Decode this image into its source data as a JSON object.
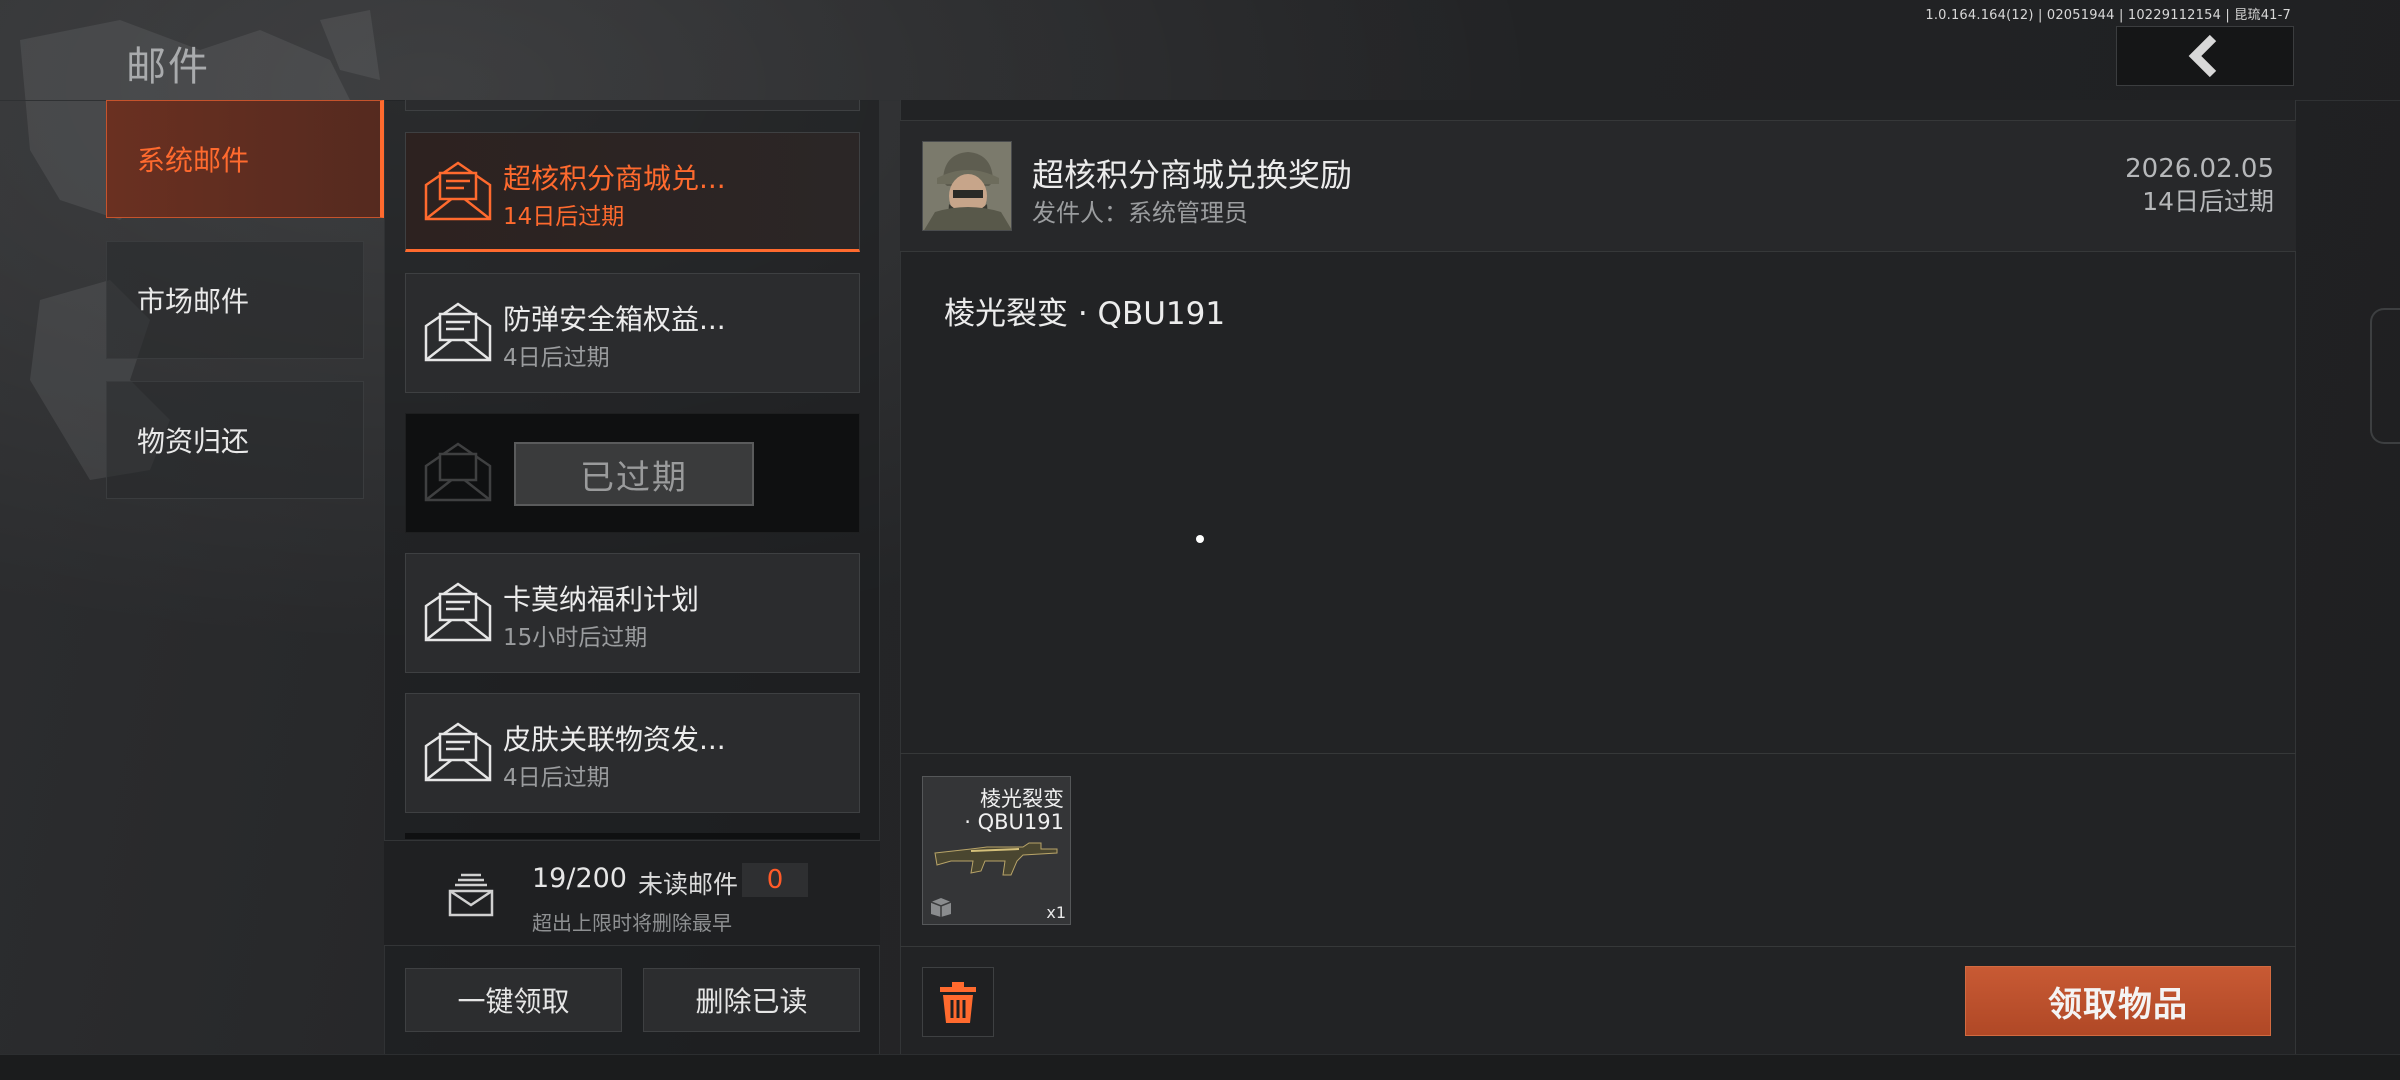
{
  "version": "1.0.164.164(12) | 02051944 | 10229112154 | 昆琉41-7",
  "page_title": "邮件",
  "categories": [
    {
      "label": "系统邮件",
      "active": true
    },
    {
      "label": "市场邮件",
      "active": false
    },
    {
      "label": "物资归还",
      "active": false
    }
  ],
  "mails": [
    {
      "title": "超核积分商城兑...",
      "sub": "14日后过期",
      "selected": true
    },
    {
      "title": "防弹安全箱权益...",
      "sub": "4日后过期"
    },
    {
      "expired_label": "已过期"
    },
    {
      "title": "卡莫纳福利计划",
      "sub": "15小时后过期"
    },
    {
      "title": "皮肤关联物资发...",
      "sub": "4日后过期"
    }
  ],
  "summary": {
    "count": "19/200",
    "unread_label": "未读邮件",
    "unread_count": "0",
    "hint": "超出上限时将删除最早"
  },
  "buttons": {
    "claim_all": "一键领取",
    "delete_read": "删除已读",
    "claim_items": "领取物品"
  },
  "detail": {
    "title": "超核积分商城兑换奖励",
    "sender": "发件人：系统管理员",
    "date": "2026.02.05",
    "expire": "14日后过期",
    "body": "棱光裂变 · QBU191",
    "reward": {
      "name_line1": "棱光裂变",
      "name_line2": "· QBU191",
      "qty": "x1"
    }
  },
  "colors": {
    "accent": "#ff6a2e",
    "claim_button": "#c0522e"
  }
}
